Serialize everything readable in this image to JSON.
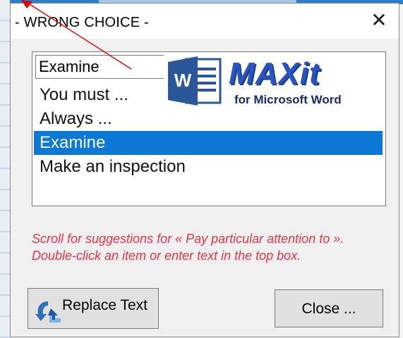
{
  "window": {
    "title": "- WRONG CHOICE -",
    "close_glyph": "✕"
  },
  "input": {
    "value": "Examine"
  },
  "list": {
    "items": [
      {
        "label": "You must ..."
      },
      {
        "label": "Always ..."
      },
      {
        "label": "Examine",
        "selected": true
      },
      {
        "label": "Make an inspection"
      }
    ]
  },
  "logo": {
    "icon": "word-icon",
    "icon_letter": "W",
    "brand": "MAXit",
    "tagline": "for Microsoft Word"
  },
  "hint": {
    "text": "Scroll for suggestions for « Pay particular attention to ». Double-click an item or enter text in the top box."
  },
  "buttons": {
    "replace": {
      "label": "Replace Text",
      "icon": "replace-arrow-icon"
    },
    "close": {
      "label": "Close ..."
    }
  },
  "colors": {
    "selection": "#0a78d4",
    "hint": "#e8334a",
    "brand": "#2a55c0",
    "word_blue": "#2b579a",
    "annotation_arrow": "#e00000"
  }
}
